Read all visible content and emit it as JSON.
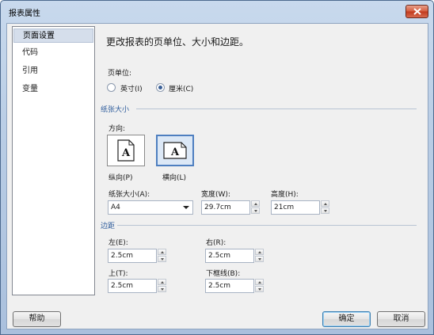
{
  "window": {
    "title": "报表属性"
  },
  "sidebar": {
    "items": [
      {
        "label": "页面设置",
        "selected": true
      },
      {
        "label": "代码"
      },
      {
        "label": "引用"
      },
      {
        "label": "变量"
      }
    ]
  },
  "main": {
    "heading": "更改报表的页单位、大小和边距。",
    "page_units": {
      "label": "页单位:",
      "options": [
        "英寸(I)",
        "厘米(C)"
      ],
      "selected": "厘米(C)"
    },
    "paper_size": {
      "section": "纸张大小",
      "orientation_label": "方向:",
      "portrait": "纵向(P)",
      "landscape": "横向(L)",
      "selected_orientation": "横向(L)",
      "size_label": "纸张大小(A):",
      "size_value": "A4",
      "width_label": "宽度(W):",
      "width_value": "29.7cm",
      "height_label": "高度(H):",
      "height_value": "21cm"
    },
    "margins": {
      "section": "边距",
      "left_label": "左(E):",
      "left_value": "2.5cm",
      "right_label": "右(R):",
      "right_value": "2.5cm",
      "top_label": "上(T):",
      "top_value": "2.5cm",
      "bottom_label": "下框线(B):",
      "bottom_value": "2.5cm"
    }
  },
  "buttons": {
    "help": "帮助",
    "ok": "确定",
    "cancel": "取消"
  }
}
